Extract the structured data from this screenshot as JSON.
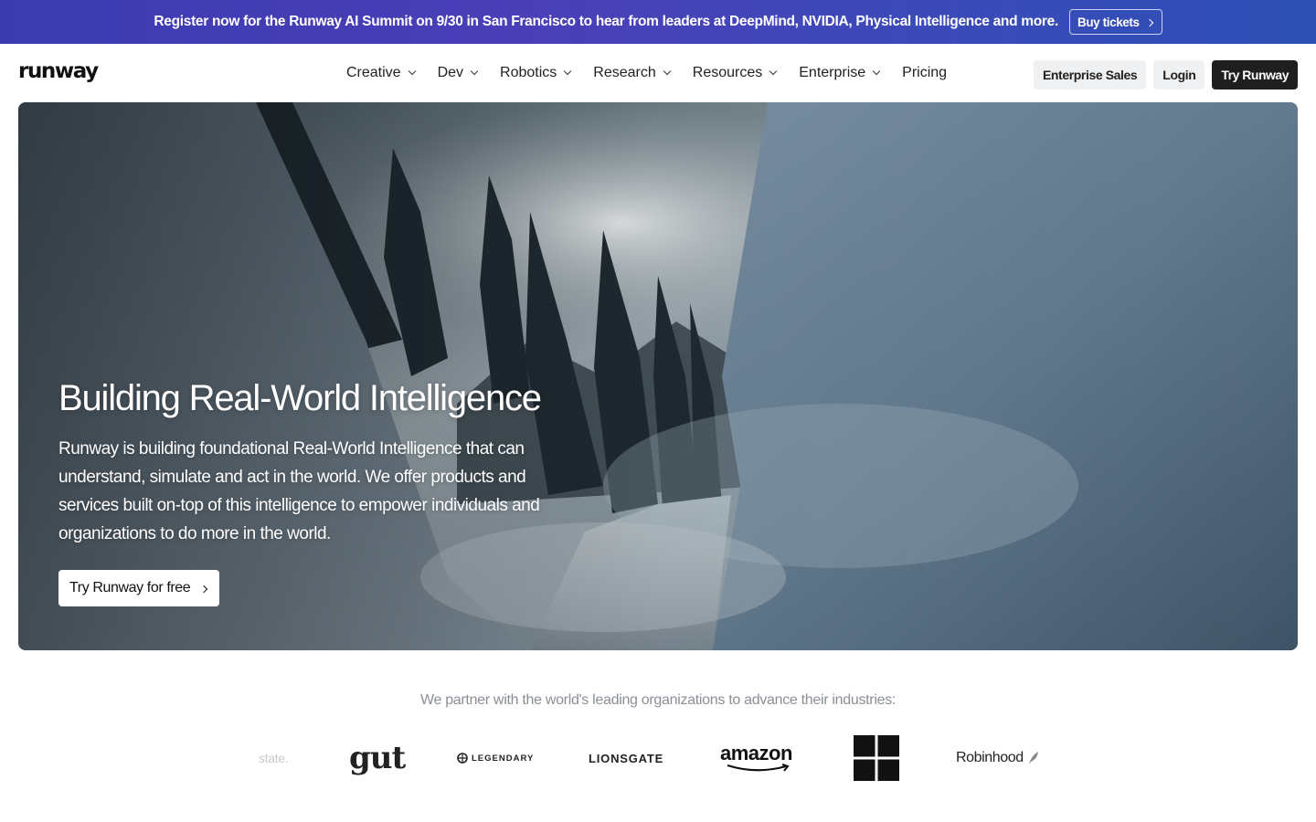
{
  "banner": {
    "text": "Register now for the Runway AI Summit on 9/30 in San Francisco to hear from leaders at DeepMind, NVIDIA, Physical Intelligence and more.",
    "button_label": "Buy tickets",
    "colors": {
      "gradient_start": "#3b3bb0",
      "gradient_end": "#2d50b5"
    }
  },
  "header": {
    "logo": "runway",
    "nav": [
      {
        "label": "Creative",
        "has_dropdown": true,
        "icon": "chevron-down-icon"
      },
      {
        "label": "Dev",
        "has_dropdown": true,
        "icon": "chevron-down-icon"
      },
      {
        "label": "Robotics",
        "has_dropdown": true,
        "icon": "chevron-down-icon"
      },
      {
        "label": "Research",
        "has_dropdown": true,
        "icon": "chevron-down-icon"
      },
      {
        "label": "Resources",
        "has_dropdown": true,
        "icon": "chevron-down-icon"
      },
      {
        "label": "Enterprise",
        "has_dropdown": true,
        "icon": "chevron-down-icon"
      },
      {
        "label": "Pricing",
        "has_dropdown": false
      }
    ],
    "actions": {
      "enterprise_sales": "Enterprise Sales",
      "login": "Login",
      "try_runway": "Try Runway"
    }
  },
  "hero": {
    "title": "Building Real-World Intelligence",
    "description": "Runway is building foundational Real-World Intelligence that can understand, simulate and act in the world. We offer products and services built on-top of this intelligence to empower individuals and organizations to do more in the world.",
    "cta_label": "Try Runway for free"
  },
  "partners": {
    "caption": "We partner with the world's leading organizations to advance their industries:",
    "logos": {
      "state": "state.",
      "gut": "gut",
      "legendary": "LEGENDARY",
      "lionsgate": "LIONSGATE",
      "amazon": "amazon",
      "microsoft": "microsoft-logo",
      "robinhood": "Robinhood"
    }
  }
}
